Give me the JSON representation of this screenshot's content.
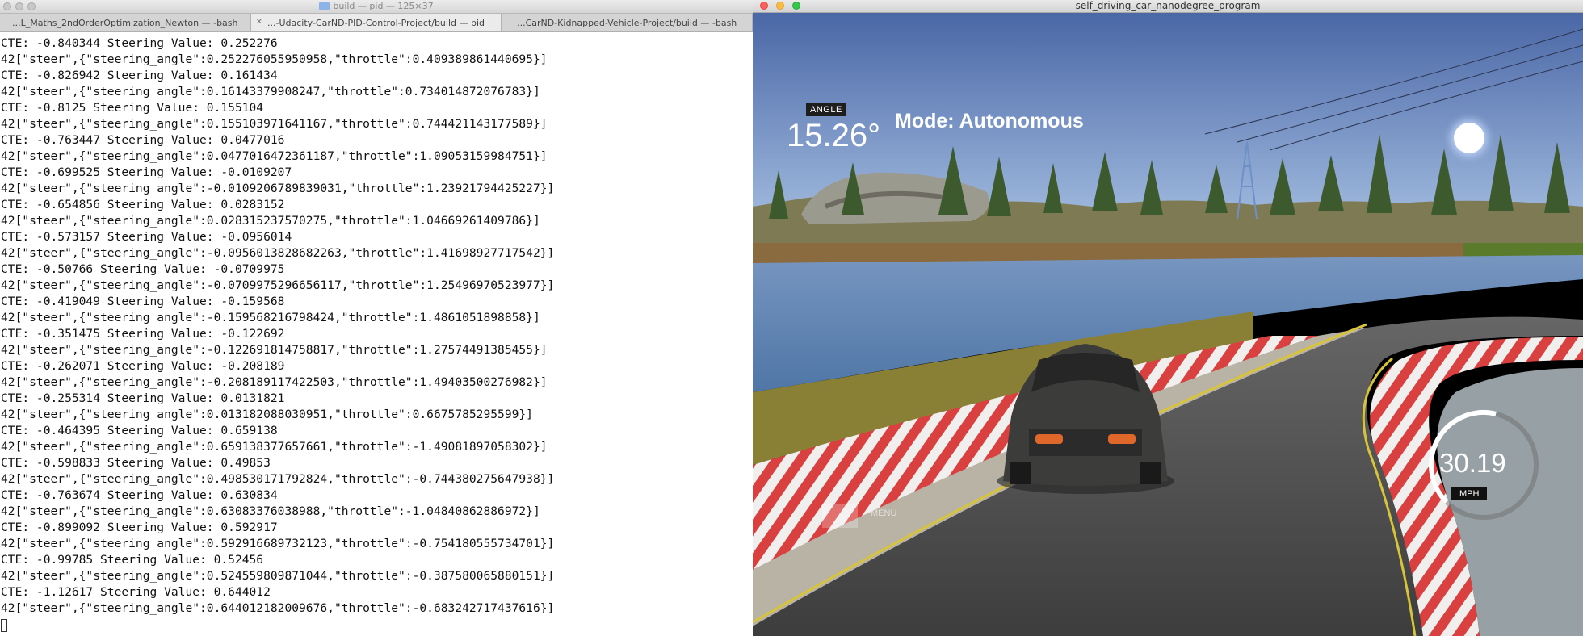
{
  "terminal": {
    "window_title": "build — pid — 125×37",
    "tabs": [
      {
        "label": "...L_Maths_2ndOrderOptimization_Newton — -bash",
        "active": false
      },
      {
        "label": "...-Udacity-CarND-PID-Control-Project/build — pid",
        "active": true
      },
      {
        "label": "...CarND-Kidnapped-Vehicle-Project/build — -bash",
        "active": false
      }
    ],
    "lines": [
      "CTE: -0.840344 Steering Value: 0.252276",
      "42[\"steer\",{\"steering_angle\":0.252276055950958,\"throttle\":0.409389861440695}]",
      "CTE: -0.826942 Steering Value: 0.161434",
      "42[\"steer\",{\"steering_angle\":0.16143379908247,\"throttle\":0.734014872076783}]",
      "CTE: -0.8125 Steering Value: 0.155104",
      "42[\"steer\",{\"steering_angle\":0.155103971641167,\"throttle\":0.744421143177589}]",
      "CTE: -0.763447 Steering Value: 0.0477016",
      "42[\"steer\",{\"steering_angle\":0.0477016472361187,\"throttle\":1.09053159984751}]",
      "CTE: -0.699525 Steering Value: -0.0109207",
      "42[\"steer\",{\"steering_angle\":-0.0109206789839031,\"throttle\":1.23921794425227}]",
      "CTE: -0.654856 Steering Value: 0.0283152",
      "42[\"steer\",{\"steering_angle\":0.028315237570275,\"throttle\":1.04669261409786}]",
      "CTE: -0.573157 Steering Value: -0.0956014",
      "42[\"steer\",{\"steering_angle\":-0.0956013828682263,\"throttle\":1.41698927717542}]",
      "CTE: -0.50766 Steering Value: -0.0709975",
      "42[\"steer\",{\"steering_angle\":-0.0709975296656117,\"throttle\":1.25496970523977}]",
      "CTE: -0.419049 Steering Value: -0.159568",
      "42[\"steer\",{\"steering_angle\":-0.159568216798424,\"throttle\":1.4861051898858}]",
      "CTE: -0.351475 Steering Value: -0.122692",
      "42[\"steer\",{\"steering_angle\":-0.122691814758817,\"throttle\":1.27574491385455}]",
      "CTE: -0.262071 Steering Value: -0.208189",
      "42[\"steer\",{\"steering_angle\":-0.208189117422503,\"throttle\":1.49403500276982}]",
      "CTE: -0.255314 Steering Value: 0.0131821",
      "42[\"steer\",{\"steering_angle\":0.013182088030951,\"throttle\":0.6675785295599}]",
      "CTE: -0.464395 Steering Value: 0.659138",
      "42[\"steer\",{\"steering_angle\":0.659138377657661,\"throttle\":-1.49081897058302}]",
      "CTE: -0.598833 Steering Value: 0.49853",
      "42[\"steer\",{\"steering_angle\":0.498530171792824,\"throttle\":-0.744380275647938}]",
      "CTE: -0.763674 Steering Value: 0.630834",
      "42[\"steer\",{\"steering_angle\":0.63083376038988,\"throttle\":-1.04840862886972}]",
      "CTE: -0.899092 Steering Value: 0.592917",
      "42[\"steer\",{\"steering_angle\":0.592916689732123,\"throttle\":-0.754180555734701}]",
      "CTE: -0.99785 Steering Value: 0.52456",
      "42[\"steer\",{\"steering_angle\":0.524559809871044,\"throttle\":-0.387580065880151}]",
      "CTE: -1.12617 Steering Value: 0.644012",
      "42[\"steer\",{\"steering_angle\":0.644012182009676,\"throttle\":-0.683242717437616}]"
    ]
  },
  "simulator": {
    "window_title": "self_driving_car_nanodegree_program",
    "hud": {
      "angle_label": "ANGLE",
      "angle_value": "15.26°",
      "mode": "Mode: Autonomous",
      "speed_value": "30.19",
      "speed_unit": "MPH",
      "menu_label": "MENU",
      "speed_gauge_fraction": 0.55
    },
    "colors": {
      "sky": "#4f6fae",
      "water": "#5f86b4",
      "road": "#4a4a4a",
      "curb_red": "#d8413f",
      "grass": "#8a8035"
    }
  }
}
